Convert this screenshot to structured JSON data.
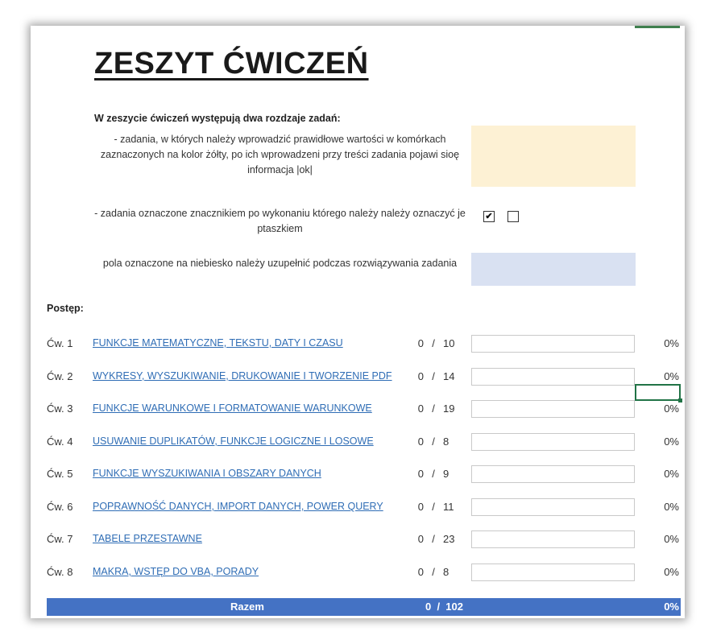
{
  "title": "ZESZYT ĆWICZEŃ",
  "intro": {
    "heading": "W zeszycie ćwiczeń występują dwa rozdzaje zadań:",
    "yellow_text": "- zadania, w których należy wprowadzić prawidłowe wartości w komórkach zaznaczonych na kolor żółty, po ich wprowadzeni przy treści zadania pojawi sioę informacja |ok|",
    "checkbox_text": "- zadania oznaczone znacznikiem po wykonaniu którego należy należy oznaczyć je ptaszkiem",
    "blue_text": "pola oznaczone na niebiesko należy uzupełnić podczas rozwiązywania zadania",
    "yellow_color": "#fdf1d4",
    "blue_color": "#d9e1f2",
    "checkbox_checked_mark": "✔"
  },
  "progress_label": "Postęp:",
  "exercises": [
    {
      "label": "Ćw. 1",
      "title": "FUNKCJE MATEMATYCZNE, TEKSTU, DATY I CZASU",
      "done": "0",
      "sep": "/",
      "total": "10",
      "progress": 0,
      "pct": "0%"
    },
    {
      "label": "Ćw. 2",
      "title": "WYKRESY, WYSZUKIWANIE, DRUKOWANIE I TWORZENIE PDF",
      "done": "0",
      "sep": "/",
      "total": "14",
      "progress": 0,
      "pct": "0%"
    },
    {
      "label": "Ćw. 3",
      "title": "FUNKCJE WARUNKOWE I FORMATOWANIE WARUNKOWE",
      "done": "0",
      "sep": "/",
      "total": "19",
      "progress": 0,
      "pct": "0%"
    },
    {
      "label": "Ćw. 4",
      "title": "USUWANIE DUPLIKATÓW, FUNKCJE LOGICZNE I LOSOWE",
      "done": "0",
      "sep": "/",
      "total": "8",
      "progress": 0,
      "pct": "0%"
    },
    {
      "label": "Ćw. 5",
      "title": "FUNKCJE WYSZUKIWANIA I OBSZARY DANYCH",
      "done": "0",
      "sep": "/",
      "total": "9",
      "progress": 0,
      "pct": "0%"
    },
    {
      "label": "Ćw. 6",
      "title": "POPRAWNOŚĆ DANYCH, IMPORT DANYCH, POWER QUERY",
      "done": "0",
      "sep": "/",
      "total": "11",
      "progress": 0,
      "pct": "0%"
    },
    {
      "label": "Ćw. 7",
      "title": "TABELE PRZESTAWNE",
      "done": "0",
      "sep": "/",
      "total": "23",
      "progress": 0,
      "pct": "0%"
    },
    {
      "label": "Ćw. 8",
      "title": "MAKRA, WSTĘP DO VBA, PORADY",
      "done": "0",
      "sep": "/",
      "total": "8",
      "progress": 0,
      "pct": "0%"
    }
  ],
  "total": {
    "label": "Razem",
    "score": "0  /  102",
    "pct": "0%"
  },
  "colors": {
    "link": "#2f6db5",
    "total_bar": "#4472c4",
    "selection": "#217346"
  }
}
